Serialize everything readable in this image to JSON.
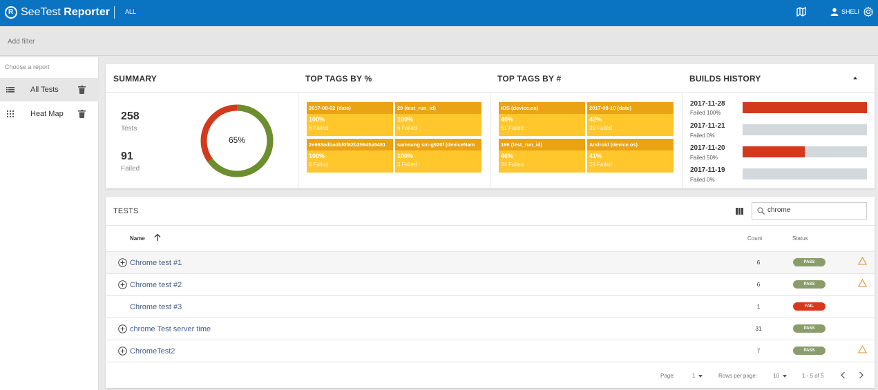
{
  "header": {
    "brand_light": "SeeTest",
    "brand_bold": "Reporter",
    "project": "ALL",
    "user": "SHELI"
  },
  "filter": {
    "placeholder": "Add filter"
  },
  "sidebar": {
    "title": "Choose a report",
    "items": [
      {
        "label": "All Tests",
        "active": true
      },
      {
        "label": "Heat Map",
        "active": false
      }
    ]
  },
  "summary": {
    "title": "SUMMARY",
    "tests_count": "258",
    "tests_label": "Tests",
    "failed_count": "91",
    "failed_label": "Failed",
    "donut_label": "65%",
    "donut_pass_fraction": 0.65,
    "colors": {
      "pass": "#6b8f2e",
      "fail": "#d2391d"
    }
  },
  "top_tags_pct": {
    "title": "TOP TAGS BY %",
    "tags": [
      {
        "name": "2017-08-02 (date)",
        "pct": "100%",
        "failed": "6 Failed"
      },
      {
        "name": "29 (test_run_id)",
        "pct": "100%",
        "failed": "6 Failed"
      },
      {
        "name": "2e663adbadbf0f82b25645a5481",
        "pct": "100%",
        "failed": "6 Failed"
      },
      {
        "name": "samsung sm-g920f (deviceNam",
        "pct": "100%",
        "failed": "3 Failed"
      }
    ]
  },
  "top_tags_num": {
    "title": "TOP TAGS BY #",
    "tags": [
      {
        "name": "iOS (device.os)",
        "pct": "40%",
        "failed": "51 Failed"
      },
      {
        "name": "2017-08-10 (date)",
        "pct": "42%",
        "failed": "39 Failed"
      },
      {
        "name": "166 (test_run_id)",
        "pct": "46%",
        "failed": "34 Failed"
      },
      {
        "name": "Android (device.os)",
        "pct": "41%",
        "failed": "29 Failed"
      }
    ]
  },
  "builds_history": {
    "title": "BUILDS HISTORY",
    "builds": [
      {
        "date": "2017-11-28",
        "failed": "Failed 100%",
        "fraction": 1.0
      },
      {
        "date": "2017-11-21",
        "failed": "Failed 0%",
        "fraction": 0.0
      },
      {
        "date": "2017-11-20",
        "failed": "Failed 50%",
        "fraction": 0.5
      },
      {
        "date": "2017-11-19",
        "failed": "Failed 0%",
        "fraction": 0.0
      }
    ]
  },
  "tests": {
    "title": "TESTS",
    "search_value": "chrome",
    "columns": {
      "name": "Name",
      "count": "Count",
      "status": "Status"
    },
    "rows": [
      {
        "name": "Chrome test #1",
        "count": "6",
        "status": "PASS",
        "expandable": true,
        "warning": true
      },
      {
        "name": "Chrome test #2",
        "count": "6",
        "status": "PASS",
        "expandable": true,
        "warning": true
      },
      {
        "name": "Chrome test #3",
        "count": "1",
        "status": "FAIL",
        "expandable": false,
        "warning": false
      },
      {
        "name": "chrome Test server time",
        "count": "31",
        "status": "PASS",
        "expandable": true,
        "warning": false
      },
      {
        "name": "ChromeTest2",
        "count": "7",
        "status": "PASS",
        "expandable": true,
        "warning": true
      }
    ],
    "pager": {
      "page_label": "Page:",
      "page_value": "1",
      "rows_label": "Rows per page:",
      "rows_value": "10",
      "range": "1 - 5 of 5"
    }
  }
}
